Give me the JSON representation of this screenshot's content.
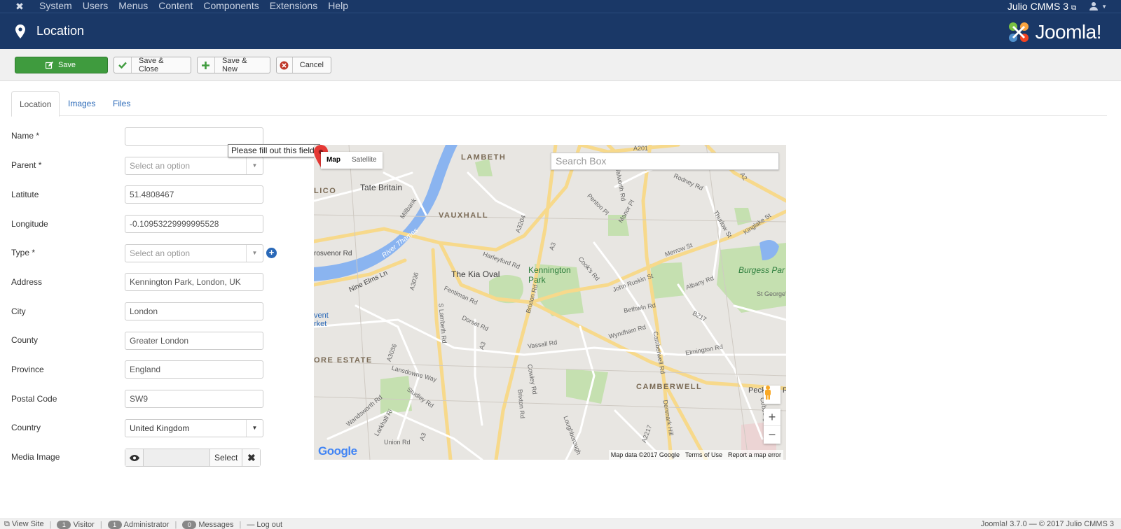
{
  "topnav": {
    "menu": [
      "System",
      "Users",
      "Menus",
      "Content",
      "Components",
      "Extensions",
      "Help"
    ],
    "site_name": "Julio CMMS 3"
  },
  "header": {
    "title": "Location",
    "brand": "Joomla!"
  },
  "toolbar": {
    "save": "Save",
    "save_close": "Save & Close",
    "save_new": "Save & New",
    "cancel": "Cancel"
  },
  "tabs": [
    "Location",
    "Images",
    "Files"
  ],
  "form": {
    "name": {
      "label": "Name *",
      "value": ""
    },
    "parent": {
      "label": "Parent *",
      "placeholder": "Select an option"
    },
    "latitude": {
      "label": "Latitute",
      "value": "51.4808467"
    },
    "longitude": {
      "label": "Longitude",
      "value": "-0.10953229999995528"
    },
    "type": {
      "label": "Type *",
      "placeholder": "Select an option"
    },
    "address": {
      "label": "Address",
      "value": "Kennington Park, London, UK"
    },
    "city": {
      "label": "City",
      "value": "London"
    },
    "county": {
      "label": "County",
      "value": "Greater London"
    },
    "province": {
      "label": "Province",
      "value": "England"
    },
    "postal_code": {
      "label": "Postal Code",
      "value": "SW9"
    },
    "country": {
      "label": "Country",
      "value": "United Kingdom"
    },
    "media_image": {
      "label": "Media Image",
      "select_label": "Select"
    },
    "tooltip": "Please fill out this field."
  },
  "map": {
    "type_map": "Map",
    "type_satellite": "Satellite",
    "search_placeholder": "Search Box",
    "zoom_in": "+",
    "zoom_out": "−",
    "google": "Google",
    "attribution": [
      "Map data ©2017 Google",
      "Terms of Use",
      "Report a map error"
    ],
    "labels": {
      "lambeth": "LAMBETH",
      "lico": "LICO",
      "tate": "Tate Britain",
      "vauxhall": "VAUXHALL",
      "river": "River Thames",
      "grosvenor": "rosvenor Rd",
      "nine_elms": "Nine Elms Ln",
      "kia_oval": "The Kia Oval",
      "kennington": "Kennington",
      "park": "Park",
      "burgess": "Burgess Par",
      "vent": "vent",
      "rket": "rket",
      "estate": "ORE ESTATE",
      "camberwell": "CAMBERWELL",
      "peckham": "Peckham R",
      "brixton": "Brixton Rd",
      "brixton2": "Brixton Rd",
      "s_lambeth": "S Lambeth Rd",
      "a3": "A3",
      "a3_2": "A3",
      "a3204": "A3204",
      "a3_3": "A3",
      "a201": "A201",
      "a2": "A2",
      "vassall": "Vassall Rd",
      "john_ruskin": "John Ruskin St",
      "albany": "Albany Rd",
      "wyndham": "Wyndham Rd",
      "camberwell_rd": "Camberwell Rd",
      "cooks": "Cook's Rd",
      "penton": "Penton Pl",
      "rodney": "Rodney Rd",
      "bethwin": "Bethwin Rd",
      "elmington": "Elmington Rd",
      "st_georges": "St George's",
      "b217": "B217",
      "wandsworth": "Wandsworth Rd",
      "lansdowne": "Lansdowne Way",
      "larkhall": "Larkhall Ri",
      "union": "Union Rd",
      "dorset": "Dorset Rd",
      "fentiman": "Fentiman Rd",
      "harleyford": "Harleyford Rd",
      "a3036": "A3036",
      "a3036_2": "A3036",
      "millbank": "Millbank",
      "denmark": "Denmark Hill",
      "a2217": "A2217",
      "studley": "Studley Rd",
      "cowley": "Cowley Rd",
      "loughborough": "Loughborough",
      "merrow": "Merrow St",
      "thurlow": "Thurlow St",
      "kinglake": "Kinglake St",
      "cobourg": "Cobourg Rd",
      "manor": "Manor Pl",
      "wanorth": "Walworth Rd"
    }
  },
  "footer": {
    "view_site": "View Site",
    "visitors_count": "1",
    "visitors": "Visitor",
    "admin_count": "1",
    "admin": "Administrator",
    "messages_count": "0",
    "messages": "Messages",
    "logout": "Log out",
    "version": "Joomla! 3.7.0  —  © 2017 Julio CMMS 3"
  },
  "colors": {
    "nav_bg": "#1a3867",
    "save_green": "#3f9b3e",
    "link_blue": "#2a69b8",
    "cancel_red": "#c0392b"
  }
}
